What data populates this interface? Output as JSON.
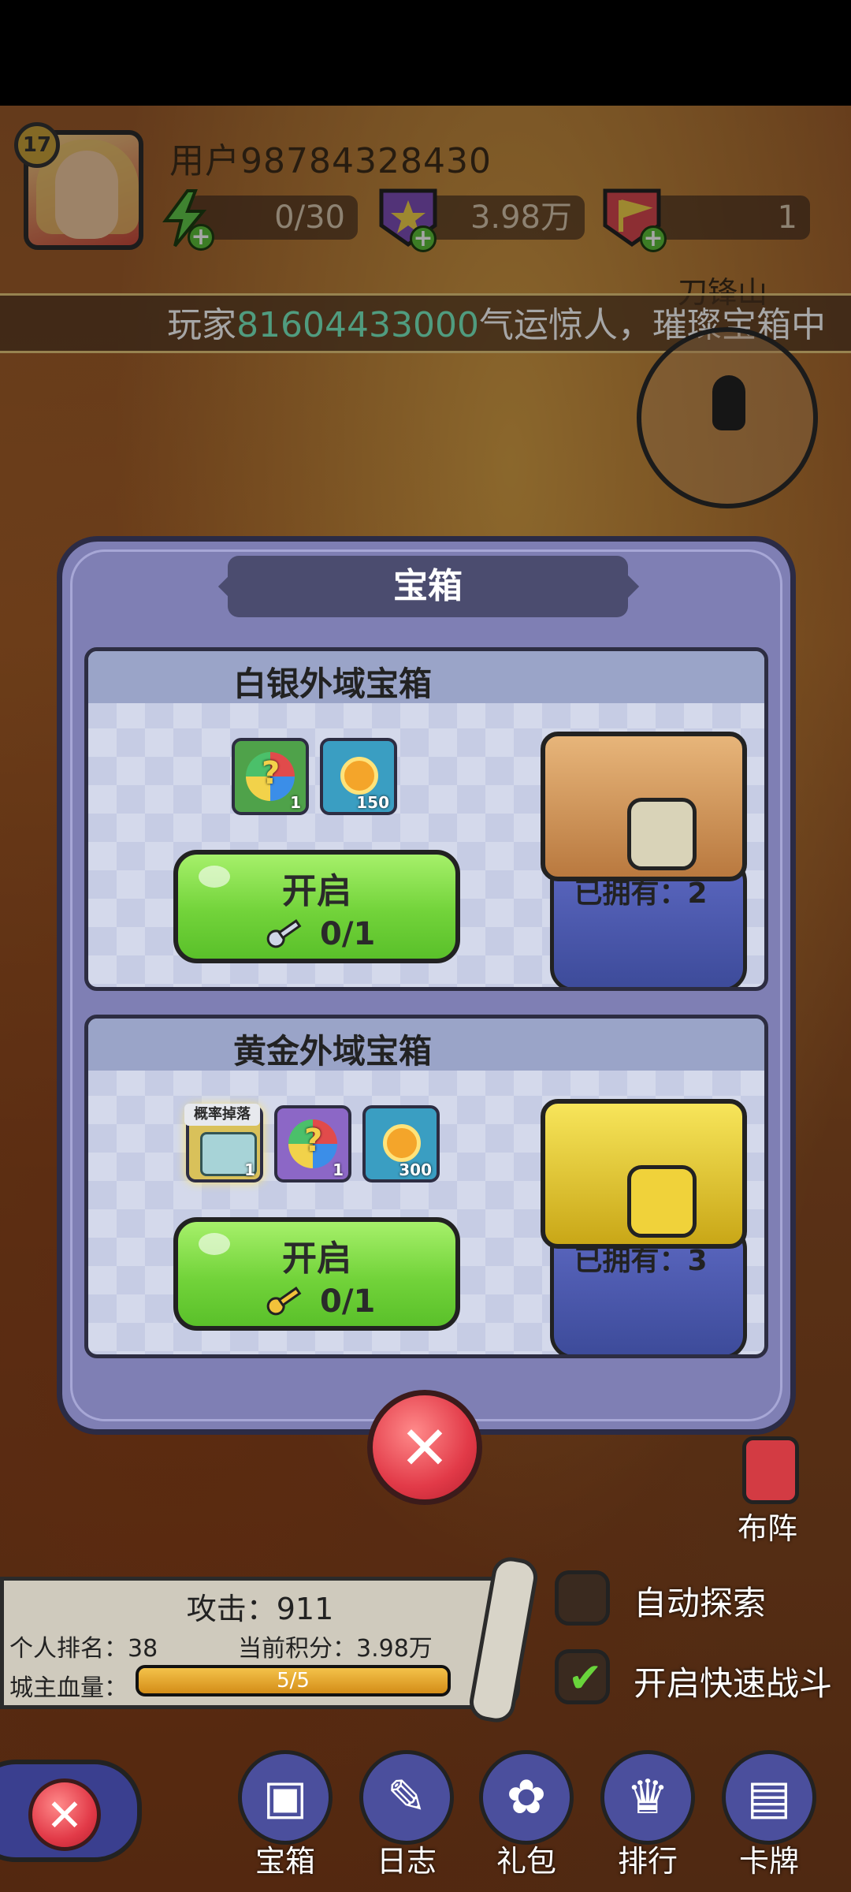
{
  "header": {
    "level": "17",
    "username": "用户98784328430",
    "resources": [
      {
        "icon": "lightning-icon",
        "value": "0/30"
      },
      {
        "icon": "purple-star-badge-icon",
        "value": "3.98万"
      },
      {
        "icon": "red-flag-badge-icon",
        "value": "1"
      }
    ],
    "location": "刀锋山"
  },
  "ticker": {
    "prefix": "玩家",
    "highlight": "81604433000",
    "suffix": "气运惊人，璀璨宝箱中",
    "highlight_color": "#7cf0c4"
  },
  "modal": {
    "title": "宝箱",
    "chests": [
      {
        "name": "白银外域宝箱",
        "rewards": [
          {
            "icon": "mixed-gems-icon",
            "qty": "1"
          },
          {
            "icon": "gold-coin-icon",
            "qty": "150"
          }
        ],
        "button_label": "开启",
        "key_icon": "silver-key-icon",
        "key_count": "0/1",
        "owned": "已拥有：2"
      },
      {
        "name": "黄金外域宝箱",
        "rewards": [
          {
            "icon": "mini-chest-icon",
            "badge": "概率掉落",
            "qty": "1"
          },
          {
            "icon": "mixed-gems-icon",
            "qty": "1"
          },
          {
            "icon": "gold-coin-icon",
            "qty": "300"
          }
        ],
        "button_label": "开启",
        "key_icon": "gold-key-icon",
        "key_count": "0/1",
        "owned": "已拥有：3"
      }
    ]
  },
  "formation": {
    "label": "布阵"
  },
  "battle": {
    "attack": "攻击：911",
    "rank": "个人排名：38",
    "score": "当前积分：3.98万",
    "hp_label": "城主血量：",
    "hp_text": "5/5",
    "hp_fraction": 1.0
  },
  "toggles": [
    {
      "label": "自动探索",
      "checked": false
    },
    {
      "label": "开启快速战斗",
      "checked": true
    }
  ],
  "nav": [
    {
      "label": "宝箱",
      "icon": "treasure-chest-icon",
      "glyph": "▣"
    },
    {
      "label": "日志",
      "icon": "log-book-icon",
      "glyph": "✎"
    },
    {
      "label": "礼包",
      "icon": "gift-bag-icon",
      "glyph": "✿"
    },
    {
      "label": "排行",
      "icon": "trophy-icon",
      "glyph": "♛"
    },
    {
      "label": "卡牌",
      "icon": "card-icon",
      "glyph": "▤"
    }
  ]
}
